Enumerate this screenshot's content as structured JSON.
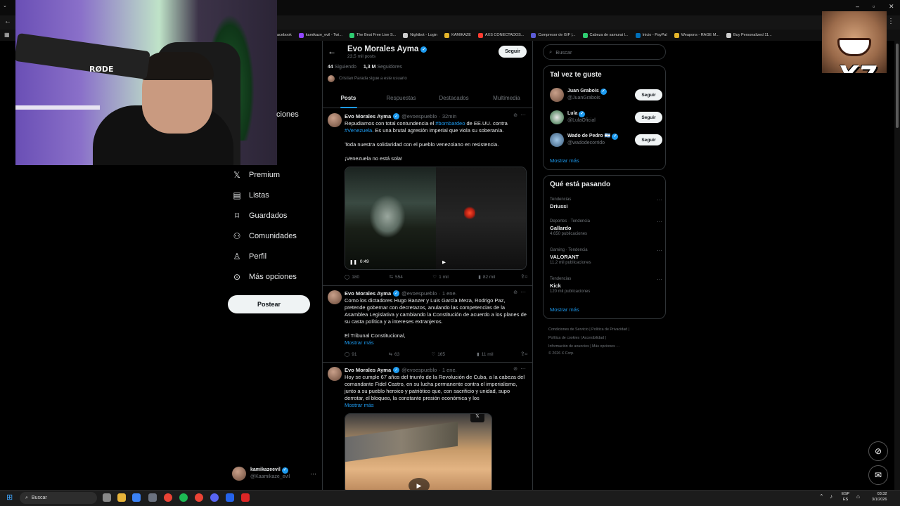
{
  "bookmarks": [
    {
      "label": "acebook",
      "color": "#1877f2"
    },
    {
      "label": "kamikaze_evil - Twi...",
      "color": "#9146ff"
    },
    {
      "label": "The Best Free Live S...",
      "color": "#2ecc71"
    },
    {
      "label": "Nightbot - Login",
      "color": "#cccccc"
    },
    {
      "label": "KAMIKAZE",
      "color": "#e4b429"
    },
    {
      "label": "AXS CONECTADOS...",
      "color": "#ff3b30"
    },
    {
      "label": "Compresor de GIF |...",
      "color": "#5b5bd6"
    },
    {
      "label": "Cabeza de samurai l...",
      "color": "#2ecc71"
    },
    {
      "label": "Inicio - PayPal",
      "color": "#0070ba"
    },
    {
      "label": "Weapons - RAGE M...",
      "color": "#e4b429"
    },
    {
      "label": "Buy Personalized 11...",
      "color": "#cccccc"
    }
  ],
  "webcam": {
    "mic_brand": "RØDE"
  },
  "meme_overlay": {
    "text": "X7"
  },
  "nav": {
    "partial_label": "ciones",
    "items": [
      {
        "label": "Premium",
        "icon": "x-logo-icon"
      },
      {
        "label": "Listas",
        "icon": "list-icon"
      },
      {
        "label": "Guardados",
        "icon": "bookmark-icon"
      },
      {
        "label": "Comunidades",
        "icon": "communities-icon"
      },
      {
        "label": "Perfil",
        "icon": "person-icon"
      },
      {
        "label": "Más opciones",
        "icon": "more-circle-icon"
      }
    ],
    "post_button": "Postear"
  },
  "account": {
    "name": "kamikazeevil",
    "handle": "@Kaamikaze_evil"
  },
  "profile": {
    "name": "Evo Morales Ayma",
    "posts_count": "23,5 mil posts",
    "follow_label": "Seguir",
    "following_count": "44",
    "following_label": "Siguiendo",
    "followers_count": "1,3 M",
    "followers_label": "Seguidores",
    "followed_by": "Cristian Parada sigue a este usuario"
  },
  "tabs": [
    "Posts",
    "Respuestas",
    "Destacados",
    "Multimedia"
  ],
  "tweets": [
    {
      "name": "Evo Morales Ayma",
      "handle": "@evoespueblo",
      "time": "· 32min",
      "line1a": "Repudiamos con total contundencia el ",
      "line1link": "#bombardeo",
      "line1b": " de EE.UU. contra",
      "line2link": "#Venezuela",
      "line2b": ". Es una brutal agresión imperial que viola su soberanía.",
      "p2": "Toda nuestra solidaridad con el pueblo venezolano en resistencia.",
      "p3": "¡Venezuela no está sola!",
      "video_time": "0:49",
      "replies": "180",
      "reposts": "554",
      "likes": "1 mil",
      "views": "82 mil"
    },
    {
      "name": "Evo Morales Ayma",
      "handle": "@evoespueblo",
      "time": "· 1 ene.",
      "p1": "Como los dictadores Hugo Banzer y Luis García Meza, Rodrigo Paz, pretende gobernar con decretazos, anulando las competencias de la Asamblea Legislativa y cambiando la Constitución de acuerdo a los planes de su casta política y a intereses extranjeros.",
      "p2": "El Tribunal Constitucional,",
      "show_more": "Mostrar más",
      "replies": "91",
      "reposts": "63",
      "likes": "165",
      "views": "11 mil"
    },
    {
      "name": "Evo Morales Ayma",
      "handle": "@evoespueblo",
      "time": "· 1 ene.",
      "p1": "Hoy se cumple 67 años del triunfo de la Revolución de Cuba, a la cabeza del comandante Fidel Castro, en su lucha permanente contra el imperialismo, junto a su pueblo heroico y patriótico que, con sacrificio y unidad, supo derrotar, el bloqueo, la constante presión económica y los",
      "show_more": "Mostrar más"
    }
  ],
  "search": {
    "placeholder": "Buscar"
  },
  "who_to_follow": {
    "title": "Tal vez te guste",
    "users": [
      {
        "name": "Juan Grabois",
        "handle": "@JuanGrabois",
        "follow": "Seguir"
      },
      {
        "name": "Lula",
        "handle": "@LulaOficial",
        "follow": "Seguir"
      },
      {
        "name": "Wado de Pedro 🇦🇷",
        "handle": "@wadodecorrido",
        "follow": "Seguir"
      }
    ],
    "show_more": "Mostrar más"
  },
  "trends": {
    "title": "Qué está pasando",
    "items": [
      {
        "context": "Tendencias",
        "name": "Driussi",
        "count": ""
      },
      {
        "context": "Deportes · Tendencia",
        "name": "Gallardo",
        "count": "4.650 publicaciones"
      },
      {
        "context": "Gaming · Tendencia",
        "name": "VALORANT",
        "count": "11,2 mil publicaciones"
      },
      {
        "context": "Tendencias",
        "name": "Kick",
        "count": "120 mil publicaciones"
      }
    ],
    "show_more": "Mostrar más"
  },
  "footer": {
    "l1a": "Condiciones de Servicio",
    "l1b": "Política de Privacidad",
    "l2a": "Política de cookies",
    "l2b": "Accesibilidad",
    "l3a": "Información de anuncios",
    "l3b": "Más opciones ···",
    "copyright": "© 2026 X Corp."
  },
  "taskbar": {
    "search": "Buscar",
    "lang1": "ESP",
    "lang2": "ES",
    "time": "03:32",
    "date": "3/1/2026"
  },
  "colors": {
    "accent": "#1d9bf0",
    "background": "#000000",
    "border": "#2f3336"
  }
}
